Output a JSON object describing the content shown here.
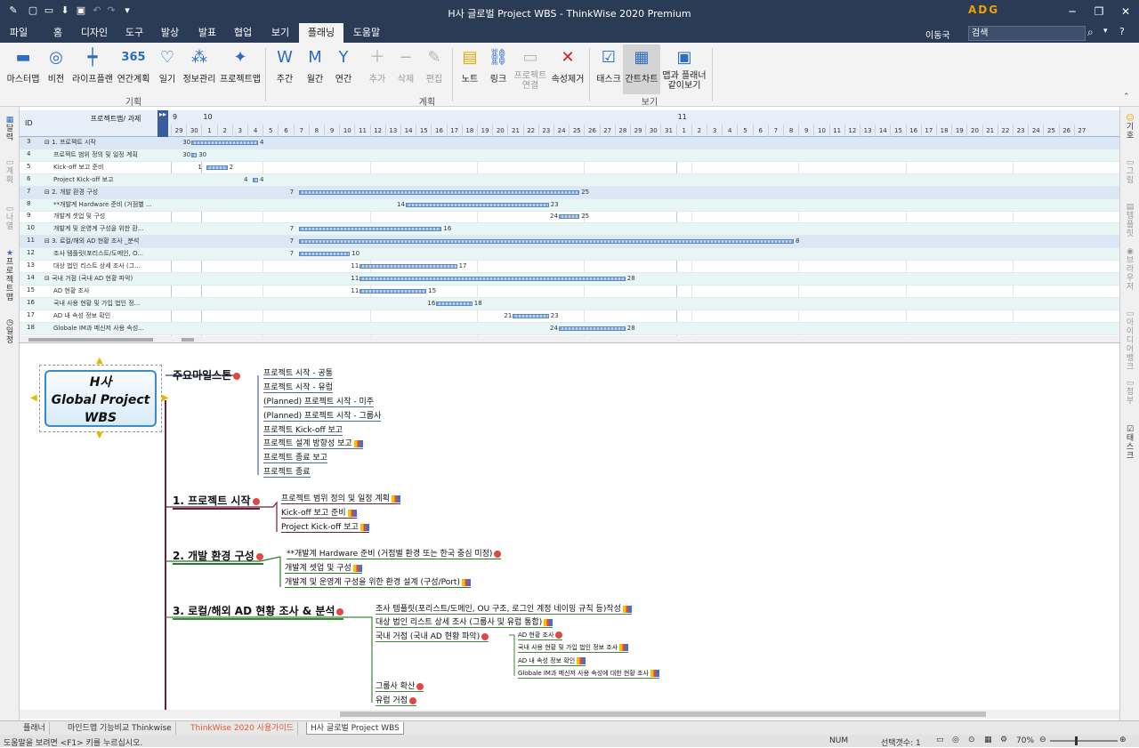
{
  "window": {
    "title": "H사 글로벌 Project WBS - ThinkWise 2020 Premium",
    "logo": "ADG"
  },
  "menu": {
    "tabs": [
      "파일",
      "홈",
      "디자인",
      "도구",
      "발상",
      "발표",
      "협업",
      "보기",
      "플래닝",
      "도움말"
    ],
    "active": "플래닝",
    "user": "이동국",
    "search_placeholder": "검색"
  },
  "ribbon": {
    "buttons": [
      {
        "label": "마스터맵",
        "icon": "master-map-icon",
        "disabled": false
      },
      {
        "label": "비전",
        "icon": "vision-icon",
        "disabled": false
      },
      {
        "label": "라이프플랜",
        "icon": "life-plan-icon",
        "disabled": false
      },
      {
        "label": "연간계획",
        "icon": "calendar-365-icon",
        "text": "365",
        "disabled": false
      },
      {
        "label": "일기",
        "icon": "diary-icon",
        "disabled": false
      },
      {
        "label": "정보관리",
        "icon": "info-manage-icon",
        "disabled": false
      },
      {
        "label": "프로젝트맵",
        "icon": "project-map-icon",
        "disabled": false
      },
      {
        "label": "주간",
        "icon": "weekly-icon",
        "disabled": false
      },
      {
        "label": "월간",
        "icon": "monthly-icon",
        "disabled": false
      },
      {
        "label": "연간",
        "icon": "yearly-icon",
        "disabled": false
      },
      {
        "label": "추가",
        "icon": "add-icon",
        "disabled": true
      },
      {
        "label": "삭제",
        "icon": "delete-icon",
        "disabled": true
      },
      {
        "label": "편집",
        "icon": "edit-icon",
        "disabled": true
      },
      {
        "label": "노트",
        "icon": "note-icon",
        "disabled": false
      },
      {
        "label": "링크",
        "icon": "link-icon",
        "disabled": false
      },
      {
        "label": "프로젝트 연결",
        "icon": "project-link-icon",
        "disabled": true
      },
      {
        "label": "속성제거",
        "icon": "remove-attr-icon",
        "disabled": false
      },
      {
        "label": "태스크",
        "icon": "task-icon",
        "disabled": false
      },
      {
        "label": "간트차트",
        "icon": "gantt-icon",
        "disabled": false
      },
      {
        "label": "맵과 플래너 같이보기",
        "icon": "map-planner-icon",
        "disabled": false
      }
    ],
    "groups": [
      "기획",
      "계획",
      "보기"
    ]
  },
  "side_left": [
    "달력",
    "계획",
    "나열",
    "프로젝트맵",
    "일정"
  ],
  "side_right": [
    "기호",
    "그림",
    "템플릿",
    "브라우저",
    "아이디어뱅크",
    "첨부",
    "태스크"
  ],
  "gantt": {
    "col_id": "ID",
    "col_task": "프로젝트맵/ 과제",
    "months": [
      "9",
      "10",
      "11"
    ],
    "days": [
      "29",
      "30",
      "1",
      "2",
      "3",
      "4",
      "5",
      "6",
      "7",
      "8",
      "9",
      "10",
      "11",
      "12",
      "13",
      "14",
      "15",
      "16",
      "17",
      "18",
      "19",
      "20",
      "21",
      "22",
      "23",
      "24",
      "25",
      "26",
      "27",
      "28",
      "29",
      "30",
      "31",
      "1",
      "2",
      "3",
      "4",
      "5",
      "6",
      "7",
      "8",
      "9",
      "10",
      "11",
      "12",
      "13",
      "14",
      "15",
      "16",
      "17",
      "18",
      "19",
      "20",
      "21",
      "22",
      "23",
      "24",
      "25",
      "26",
      "27"
    ],
    "rows": [
      {
        "id": "3",
        "task": "⊟ 1. 프로젝트 시작",
        "start": "30",
        "end": "4",
        "summary": true
      },
      {
        "id": "4",
        "task": "프로젝트 범위 정의 및 일정 계획",
        "start": "30",
        "end": "30"
      },
      {
        "id": "5",
        "task": "Kick-off 보고 준비",
        "start": "1",
        "end": "2"
      },
      {
        "id": "6",
        "task": "Project Kick-off 보고",
        "start": "4",
        "end": "4"
      },
      {
        "id": "7",
        "task": "⊟ 2. 개발 환경 구성",
        "start": "7",
        "end": "25",
        "summary": true
      },
      {
        "id": "8",
        "task": "**개발계 Hardware 준비 (거점별 ...",
        "start": "14",
        "end": "23"
      },
      {
        "id": "9",
        "task": "개발계 셋업 및 구성",
        "start": "24",
        "end": "25"
      },
      {
        "id": "10",
        "task": "개발계 및 운영계 구성을 위한 환...",
        "start": "7",
        "end": "16"
      },
      {
        "id": "11",
        "task": "⊟ 3. 로컬/해외 AD 현황 조사 _분석",
        "start": "7",
        "end": "8",
        "summary": true
      },
      {
        "id": "12",
        "task": "조사 템플릿(포리스트/도메인, O...",
        "start": "7",
        "end": "10"
      },
      {
        "id": "13",
        "task": "대상 법인 리스트 상세 조사 (그...",
        "start": "11",
        "end": "17"
      },
      {
        "id": "14",
        "task": "⊟ 국내 거점 (국내 AD 현황 파악)",
        "start": "11",
        "end": "28"
      },
      {
        "id": "15",
        "task": "AD 현황 조사",
        "start": "11",
        "end": "15"
      },
      {
        "id": "16",
        "task": "국내 사용 현황 및 가입 법인 정...",
        "start": "16",
        "end": "18"
      },
      {
        "id": "17",
        "task": "AD 내 속성 정보 확인",
        "start": "21",
        "end": "23"
      },
      {
        "id": "18",
        "task": "Globale IM과 메신저 사용 속성...",
        "start": "24",
        "end": "28"
      }
    ]
  },
  "mindmap": {
    "central": [
      "H사",
      "Global Project",
      "WBS"
    ],
    "branches": [
      {
        "label": "주요마일스톤",
        "children": [
          "프로젝트 시작 - 공통",
          "프로젝트 시작 - 유럽",
          "(Planned) 프로젝트 시작 - 미주",
          "(Planned) 프로젝트 시작 - 그룹사",
          "프로젝트 Kick-off 보고",
          "프로젝트 설계 방향성 보고",
          "프로젝트 종료 보고",
          "프로젝트 종료"
        ]
      },
      {
        "label": "1. 프로젝트 시작",
        "children": [
          "프로젝트 범위 정의 및 일정 계획",
          "Kick-off 보고 준비",
          "Project Kick-off 보고"
        ]
      },
      {
        "label": "2. 개발 환경 구성",
        "children": [
          "**개발계 Hardware 준비 (거점별 환경 또는 한국 중심 미정)",
          "개발계 셋업 및 구성",
          "개발계 및 운영계 구성을 위한 환경 설계 (구성/Port)"
        ]
      },
      {
        "label": "3. 로컬/해외 AD 현황 조사 & 분석",
        "children": [
          "조사 템플릿(포리스트/도메인, OU 구조, 로그인 계정 네이밍 규칙 등)작성",
          "대상 법인 리스트 상세 조사 (그룹사 및 유럽 통합)",
          "국내 거점 (국내 AD 현황 파악)",
          "그룹사 확산",
          "유럽 거점"
        ],
        "grandchildren": [
          "AD 현황 조사",
          "국내 사용 현황 및 가입 법인 정보 조사",
          "AD 내 속성 정보 확인",
          "Globale IM과 메신저 사용 속성에 대한 현황 조사"
        ]
      }
    ]
  },
  "doc_tabs": [
    "플래너",
    "마인드맵 기능비교 Thinkwise",
    "ThinkWise 2020 사용가이드",
    "H사 글로벌 Project WBS"
  ],
  "active_doc": "H사 글로벌 Project WBS",
  "status": {
    "help": "도움말을 보려면 <F1> 키를 누르십시오.",
    "num": "NUM",
    "selection": "선택갯수: 1",
    "zoom": "70%"
  },
  "colors": {
    "accent": "#2b3a55",
    "summary_row": "#dbe7f4",
    "alt_row": "#e8f6f6",
    "branch_line": "#6d1f3a",
    "link_tab": "#e05a2a"
  }
}
